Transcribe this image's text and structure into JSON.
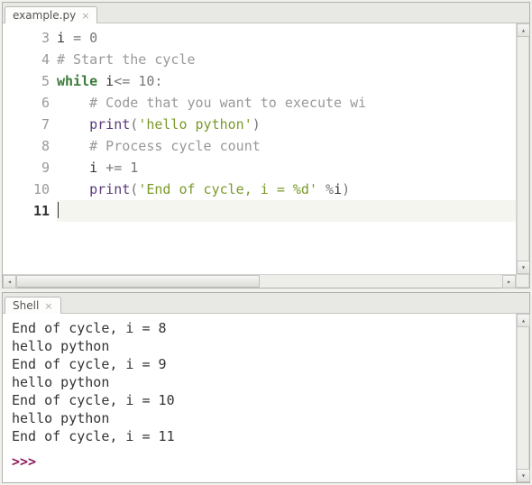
{
  "editor": {
    "tab_label": "example.py",
    "active_line_index": 8,
    "lines": [
      {
        "n": 3,
        "tokens": [
          [
            "",
            "i "
          ],
          [
            "op",
            "= "
          ],
          [
            "num",
            "0"
          ]
        ]
      },
      {
        "n": 4,
        "tokens": [
          [
            "cmt",
            "# Start the cycle"
          ]
        ]
      },
      {
        "n": 5,
        "tokens": [
          [
            "kw",
            "while"
          ],
          [
            "",
            " i"
          ],
          [
            "op",
            "<= "
          ],
          [
            "num",
            "10"
          ],
          [
            "op",
            ":"
          ]
        ]
      },
      {
        "n": 6,
        "tokens": [
          [
            "",
            "    "
          ],
          [
            "cmt",
            "# Code that you want to execute wi"
          ]
        ]
      },
      {
        "n": 7,
        "tokens": [
          [
            "",
            "    "
          ],
          [
            "builtin",
            "print"
          ],
          [
            "op",
            "("
          ],
          [
            "str",
            "'hello python'"
          ],
          [
            "op",
            ")"
          ]
        ]
      },
      {
        "n": 8,
        "tokens": [
          [
            "",
            "    "
          ],
          [
            "cmt",
            "# Process cycle count"
          ]
        ]
      },
      {
        "n": 9,
        "tokens": [
          [
            "",
            "    i "
          ],
          [
            "op",
            "+= "
          ],
          [
            "num",
            "1"
          ]
        ]
      },
      {
        "n": 10,
        "tokens": [
          [
            "",
            "    "
          ],
          [
            "builtin",
            "print"
          ],
          [
            "op",
            "("
          ],
          [
            "str",
            "'End of cycle, i = %d'"
          ],
          [
            "",
            " "
          ],
          [
            "op",
            "%"
          ],
          [
            "",
            "i"
          ],
          [
            "op",
            ")"
          ]
        ]
      },
      {
        "n": 11,
        "tokens": [
          [
            "",
            ""
          ]
        ]
      }
    ]
  },
  "shell": {
    "tab_label": "Shell",
    "output": [
      "End of cycle, i = 8",
      "hello python",
      "End of cycle, i = 9",
      "hello python",
      "End of cycle, i = 10",
      "hello python",
      "End of cycle, i = 11"
    ],
    "prompt": ">>>"
  }
}
